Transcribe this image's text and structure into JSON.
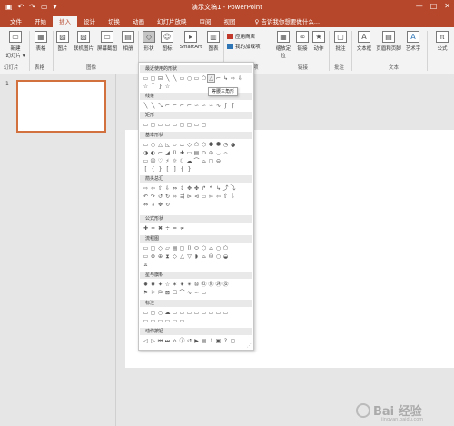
{
  "window": {
    "title": "演示文稿1 - PowerPoint",
    "qat_icons": [
      "save-icon",
      "undo-icon",
      "redo-icon",
      "start-slideshow-icon",
      "customize-icon"
    ],
    "controls": [
      "—",
      "□",
      "✕"
    ]
  },
  "tabs": [
    "文件",
    "开始",
    "插入",
    "设计",
    "切换",
    "动画",
    "幻灯片放映",
    "审阅",
    "视图"
  ],
  "active_tab": "插入",
  "tell_me": "♀ 告诉我你想要做什么...",
  "ribbon": {
    "new_slide": "新建\n幻灯片 ▾",
    "table": "表格",
    "picture": "图片",
    "online_picture": "联机图片",
    "screenshot": "屏幕截图",
    "album": "相册",
    "shapes": "形状",
    "icons": "图标",
    "smartart": "SmartArt",
    "chart": "图表",
    "store": "应用商店",
    "my_addins": "我的加载项",
    "zoom": "缩放定\n位",
    "link": "链接",
    "action": "动作",
    "comment": "批注",
    "textbox": "文本框",
    "header_footer": "页眉和页脚",
    "wordart": "艺术字",
    "formula": "公式",
    "groups": {
      "slides": "幻灯片",
      "tables": "表格",
      "images": "图像",
      "addins": "加载项",
      "links": "链接",
      "comments": "批注",
      "text": "文本"
    }
  },
  "slide_number": "1",
  "dropdown": {
    "sections": [
      "最近使用的形状",
      "线条",
      "矩形",
      "基本形状",
      "箭头总汇",
      "公式形状",
      "流程图",
      "星与旗帜",
      "标注",
      "动作按钮"
    ],
    "tooltip": "等腰三角形",
    "grip": "⋰"
  },
  "watermark": {
    "text": "Bai 经验",
    "sub": "jingyan.baidu.com"
  },
  "colors": {
    "accent": "#b7472a",
    "thumb_border": "#d2703e"
  }
}
